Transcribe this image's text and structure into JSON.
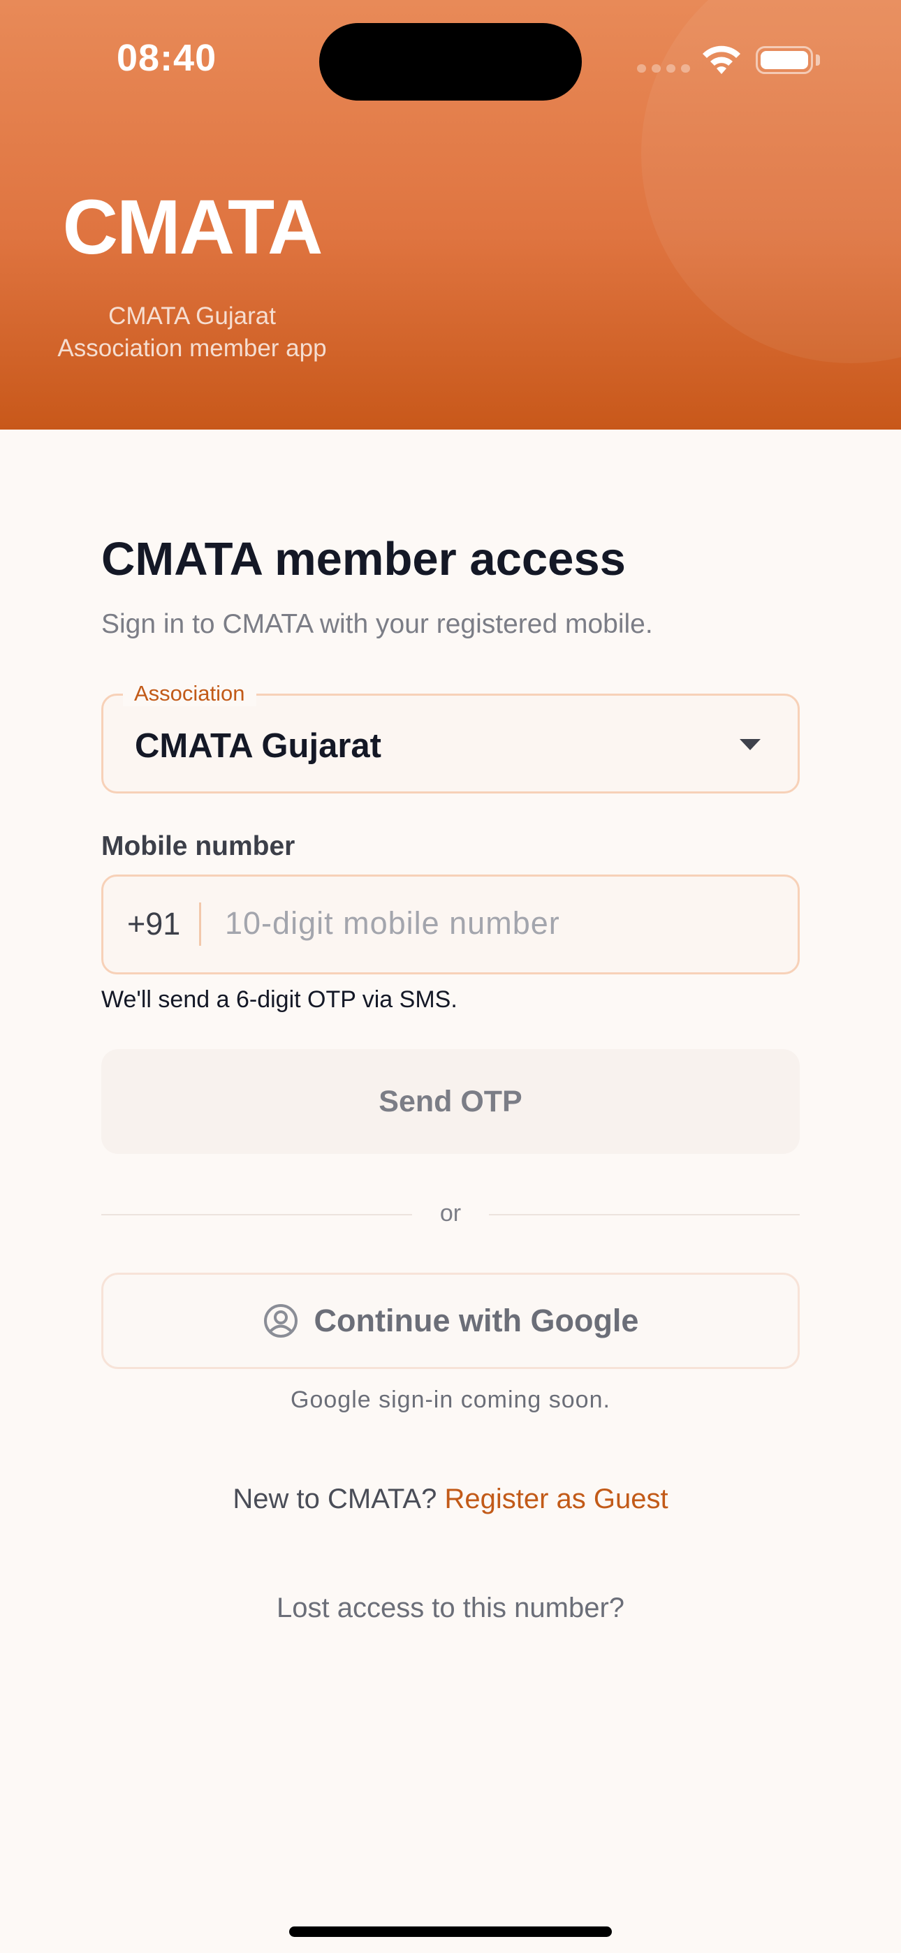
{
  "status_bar": {
    "time": "08:40"
  },
  "header": {
    "title": "CMATA",
    "subtitle_line1": "CMATA Gujarat",
    "subtitle_line2": "Association member app"
  },
  "main": {
    "title": "CMATA member access",
    "subtitle": "Sign in to CMATA with your registered mobile.",
    "association": {
      "label": "Association",
      "value": "CMATA Gujarat"
    },
    "mobile": {
      "label": "Mobile number",
      "dial_code": "+91",
      "value": "",
      "placeholder": "10-digit mobile number",
      "hint": "We'll send a 6-digit OTP via SMS."
    },
    "send_otp_label": "Send OTP",
    "divider_text": "or",
    "google_label": "Continue with Google",
    "google_hint": "Google sign-in coming soon.",
    "register_prefix": "New to CMATA?",
    "register_link": "Register as Guest",
    "lost_access_label": "Lost access to this number?"
  },
  "icons": {
    "wifi": "wifi-icon",
    "battery": "battery-icon",
    "dropdown": "chevron-down-icon",
    "google": "user-circle-icon"
  },
  "colors": {
    "header_top": "#e88a58",
    "header_bottom": "#c8581a",
    "accent": "#c25a18",
    "background": "#fdf9f6"
  }
}
